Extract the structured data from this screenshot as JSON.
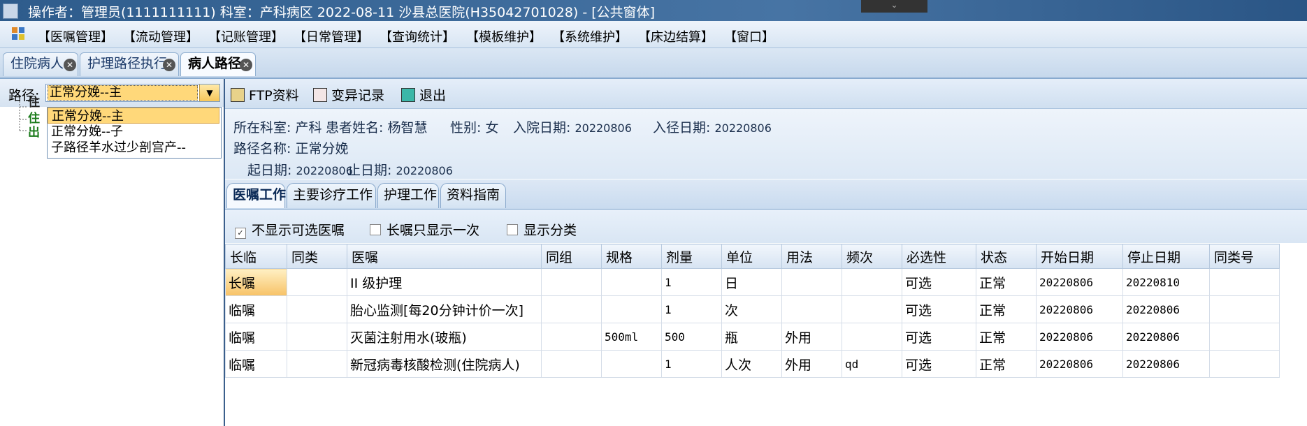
{
  "window": {
    "title": "操作者：管理员(1111111111)  科室：产科病区  2022-08-11  沙县总医院(H35042701028) - [公共窗体]",
    "top_button_glyph": "⌄"
  },
  "menu": {
    "items": [
      "【医嘱管理】",
      "【流动管理】",
      "【记账管理】",
      "【日常管理】",
      "【查询统计】",
      "【模板维护】",
      "【系统维护】",
      "【床边结算】",
      "【窗口】"
    ]
  },
  "tabs": [
    {
      "label": "住院病人"
    },
    {
      "label": "护理路径执行"
    },
    {
      "label": "病人路径"
    }
  ],
  "left": {
    "path_label": "路径:",
    "path_value": "正常分娩--主",
    "options": [
      "正常分娩--主",
      "正常分娩--子",
      "子路径羊水过少剖宫产--"
    ],
    "tree_fragments": [
      "住",
      "住",
      "出"
    ]
  },
  "toolbar": {
    "ftp_label": "FTP资料",
    "variance_label": "变异记录",
    "exit_label": "退出"
  },
  "info": {
    "dept_label": "所在科室:",
    "dept_value": "产科",
    "name_label": "患者姓名:",
    "name_value": "杨智慧",
    "sex_label": "性别:",
    "sex_value": "女",
    "admit_label": "入院日期:",
    "admit_value": "20220806",
    "enter_label": "入径日期:",
    "enter_value": "20220806",
    "path_name_label": "路径名称:",
    "path_name_value": "正常分娩",
    "start_label": "起日期:",
    "start_value": "20220806",
    "end_label": "止日期:",
    "end_value": "20220806"
  },
  "inner_tabs": [
    "医嘱工作",
    "主要诊疗工作",
    "护理工作",
    "资料指南"
  ],
  "options": {
    "hide_optional": "不显示可选医嘱",
    "long_once": "长嘱只显示一次",
    "show_category": "显示分类",
    "hide_optional_checked": true
  },
  "table": {
    "headers": [
      "长临",
      "同类",
      "医嘱",
      "同组",
      "规格",
      "剂量",
      "单位",
      "用法",
      "频次",
      "必选性",
      "状态",
      "开始日期",
      "停止日期",
      "同类号"
    ],
    "rows": [
      [
        "长嘱",
        "",
        "II 级护理",
        "",
        "",
        "1",
        "日",
        "",
        "",
        "可选",
        "正常",
        "20220806",
        "20220810",
        ""
      ],
      [
        "临嘱",
        "",
        "胎心监测[每20分钟计价一次]",
        "",
        "",
        "1",
        "次",
        "",
        "",
        "可选",
        "正常",
        "20220806",
        "20220806",
        ""
      ],
      [
        "临嘱",
        "",
        "灭菌注射用水(玻瓶)",
        "",
        "500ml",
        "500",
        "瓶",
        "外用",
        "",
        "可选",
        "正常",
        "20220806",
        "20220806",
        ""
      ],
      [
        "临嘱",
        "",
        "新冠病毒核酸检测(住院病人)",
        "",
        "",
        "1",
        "人次",
        "外用",
        "qd",
        "可选",
        "正常",
        "20220806",
        "20220806",
        ""
      ]
    ]
  }
}
